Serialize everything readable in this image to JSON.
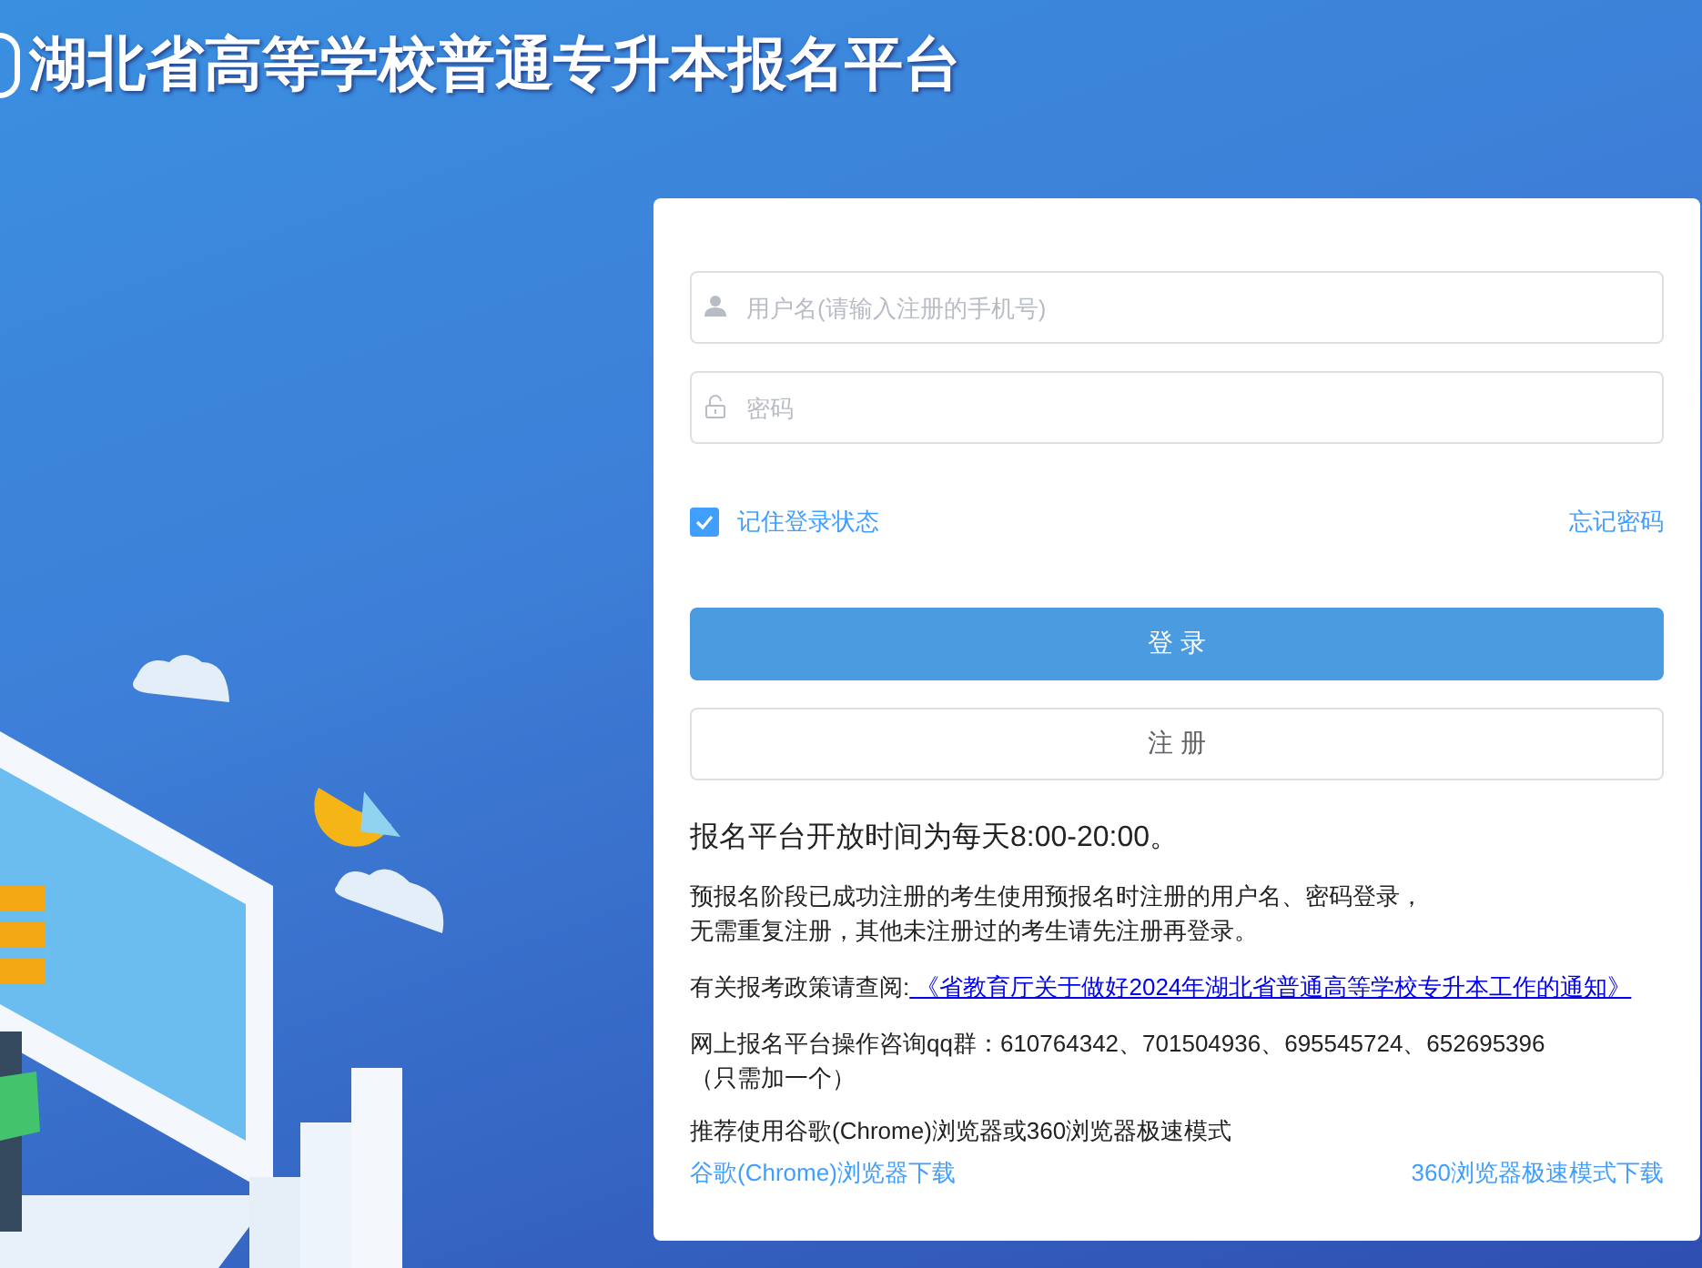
{
  "header": {
    "title": "湖北省高等学校普通专升本报名平台"
  },
  "login": {
    "username": {
      "placeholder": "用户名(请输入注册的手机号)"
    },
    "password": {
      "placeholder": "密码"
    },
    "remember": {
      "label": "记住登录状态",
      "checked": true
    },
    "forgot": "忘记密码",
    "buttons": [
      {
        "label": "登 录",
        "kind": "primary"
      },
      {
        "label": "注 册",
        "kind": "secondary"
      }
    ],
    "hours": "报名平台开放时间为每天8:00-20:00。",
    "notes": [
      "预报名阶段已成功注册的考生使用预报名时注册的用户名、密码登录，",
      "无需重复注册，其他未注册过的考生请先注册再登录。"
    ],
    "policy": {
      "prefix": "有关报考政策请查阅:",
      "link": " 《省教育厅关于做好2024年湖北省普通高等学校专升本工作的通知》"
    },
    "qq": [
      "网上报名平台操作咨询qq群：610764342、701504936、695545724、652695396",
      "（只需加一个）"
    ],
    "browser_tip": "推荐使用谷歌(Chrome)浏览器或360浏览器极速模式",
    "downloads": [
      "谷歌(Chrome)浏览器下载",
      "360浏览器极速模式下载"
    ]
  }
}
